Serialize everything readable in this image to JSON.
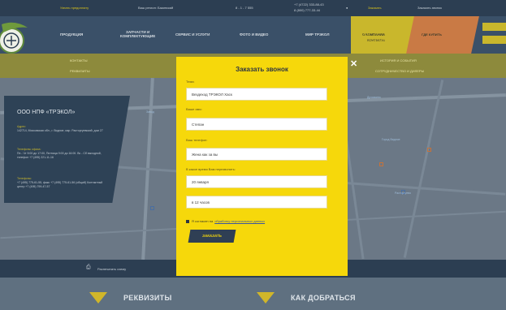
{
  "topbar": {
    "link1": "Узнать предоплату",
    "link2": "Ваш регион: Бакинский",
    "phone_short": "8 ‑ 1 - 7 555",
    "phone_lines": "+7 (4722) 333-88-43",
    "phone_lines2": "8 (800) 777-33-44",
    "cart_label": "Заказать",
    "callback": "Заказать звонок"
  },
  "nav": {
    "items": [
      "ПРОДУКЦИЯ",
      "ЗАПЧАСТИ И\nКОМПЛЕКТУЮЩИЕ",
      "СЕРВИС И УСЛУГИ",
      "ФОТО И ВИДЕО",
      "МИР ТРЭКОЛ"
    ],
    "yellow_tab": "О КОМПАНИИ",
    "yellow_tab_sub": "КОНТАКТЫ",
    "orange_tab": "ГДЕ КУПИТЬ"
  },
  "subnav": {
    "left1": "КОНТАКТЫ",
    "left2": "РЕКВИЗИТЫ",
    "right1": "ИСТОРИЯ И СОБЫТИЯ",
    "right2": "СОТРУДНИЧЕСТВО И ДИЛЕРЫ"
  },
  "info": {
    "title": "ООО НПФ «ТРЭКОЛ»",
    "addr_label": "Адрес:",
    "addr_text": "142714, Московская обл., г. Видное, мкр. Расторгуевский, дом 27",
    "phone_label": "Телефоны офиса:",
    "phone_text": "Пн - Чт 9:00 до 17:00, Пятница 9:00 до 16:00. Вс - Сб выходной, телефон +7 (495) 221-11-16",
    "sales_label": "Телефоны:",
    "sales_text": "+7 (495) 775-61-55, факс +7 (495) 775-61-56 (общий) Контактный центр +7 (495) 799-47-57"
  },
  "map_labels": [
    "Дрожжино",
    "Город Видное",
    "Расторгуево",
    "Завод"
  ],
  "strip": {
    "print_label": "Распечатать схему"
  },
  "footer": {
    "btn1": "РЕКВИЗИТЫ",
    "btn2": "КАК ДОБРАТЬСЯ"
  },
  "modal": {
    "title": "Заказать звонок",
    "topic_label": "Тема:",
    "topic_value": "Вездеход ТРЭКОЛ Хаск",
    "name_label": "Ваше имя:",
    "name_value": "Степан",
    "phone_label": "Ваш телефон:",
    "phone_value": "Жена как за вы",
    "time_label": "В какое время Вам перезвонить:",
    "date_value": "20 января",
    "time_value": "в 12 часов",
    "consent_text": "Я согласен на",
    "consent_link": "обработку персональных данных",
    "submit": "ЗАКАЗАТЬ",
    "close": "✕"
  },
  "colors": {
    "modal_bg": "#f6d80b",
    "submit_bg": "#2f3f54",
    "accent": "#c9b72c",
    "header": "#2c3e52"
  }
}
